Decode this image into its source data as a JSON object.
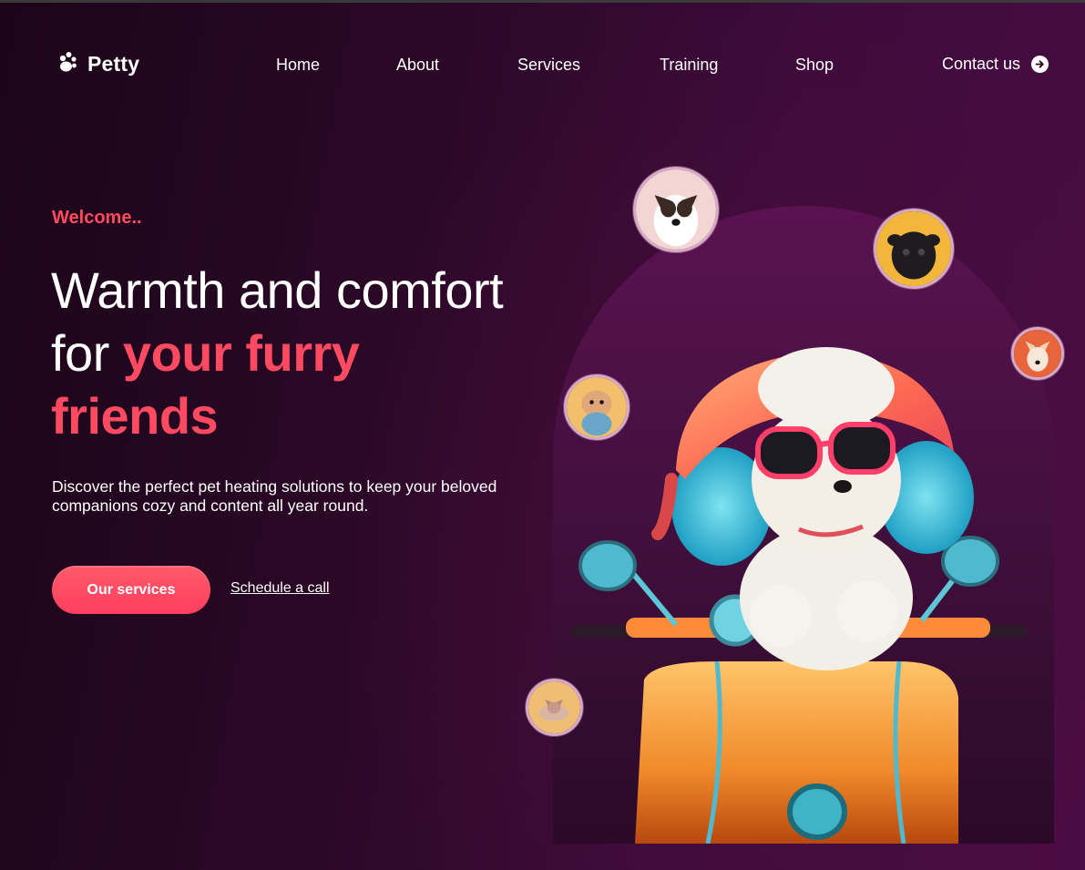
{
  "brand": {
    "name": "Petty"
  },
  "nav": {
    "items": [
      "Home",
      "About",
      "Services",
      "Training",
      "Shop"
    ],
    "contact_label": "Contact us"
  },
  "hero": {
    "eyebrow": "Welcome..",
    "headline_line1": "Warmth and comfort",
    "headline_line2_plain": "for ",
    "headline_line2_accent": "your furry",
    "headline_line3_accent": "friends",
    "description": "Discover the perfect pet heating solutions to keep your beloved companions cozy and content all year round.",
    "primary_button": "Our services",
    "secondary_link": "Schedule a call"
  },
  "colors": {
    "accent": "#ff4a62",
    "background_dark": "#1c0519",
    "background_purple": "#4a0c45",
    "arch": "#5a1250"
  },
  "icons": {
    "logo": "paw-icon",
    "contact": "arrow-right-circle-icon"
  }
}
